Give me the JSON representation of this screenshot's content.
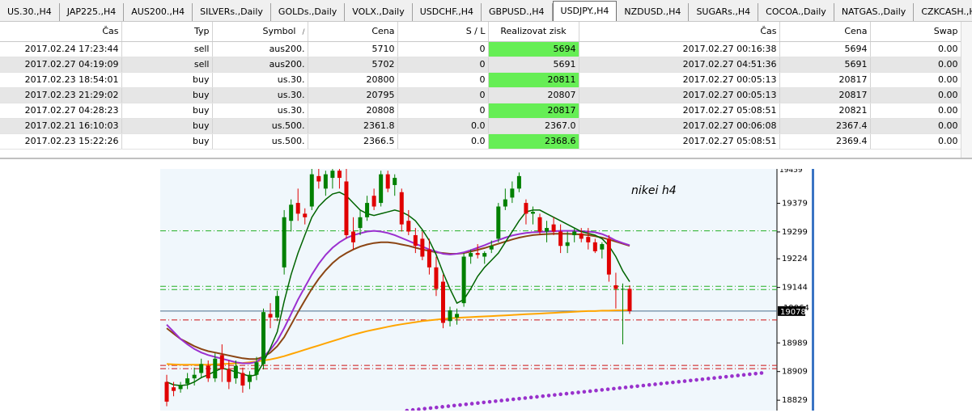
{
  "tabs": [
    {
      "label": "US.30.,H4",
      "active": false
    },
    {
      "label": "JAP225.,H4",
      "active": false
    },
    {
      "label": "AUS200.,H4",
      "active": false
    },
    {
      "label": "SILVERs.,Daily",
      "active": false
    },
    {
      "label": "GOLDs.,Daily",
      "active": false
    },
    {
      "label": "VOLX.,Daily",
      "active": false
    },
    {
      "label": "USDCHF.,H4",
      "active": false
    },
    {
      "label": "GBPUSD.,H4",
      "active": false
    },
    {
      "label": "USDJPY.,H4",
      "active": true
    },
    {
      "label": "NZDUSD.,H4",
      "active": false
    },
    {
      "label": "SUGARs.,H4",
      "active": false
    },
    {
      "label": "COCOA.,Daily",
      "active": false
    },
    {
      "label": "NATGAS.,Daily",
      "active": false
    },
    {
      "label": "CZKCASH.,H4",
      "active": false
    }
  ],
  "table": {
    "headers": {
      "open_time": "Čas",
      "type": "Typ",
      "symbol": "Symbol",
      "open_price": "Cena",
      "sl": "S / L",
      "tp": "Realizovat zisk",
      "close_time": "Čas",
      "close_price": "Cena",
      "swap": "Swap"
    },
    "sort_glyph": "/",
    "rows": [
      {
        "open_time": "2017.02.24 17:23:44",
        "type": "sell",
        "symbol": "aus200.",
        "open_price": "5710",
        "sl": "0",
        "tp": "5694",
        "close_time": "2017.02.27 00:16:38",
        "close_price": "5694",
        "swap": "0.00"
      },
      {
        "open_time": "2017.02.27 04:19:09",
        "type": "sell",
        "symbol": "aus200.",
        "open_price": "5702",
        "sl": "0",
        "tp": "5691",
        "close_time": "2017.02.27 04:51:36",
        "close_price": "5691",
        "swap": "0.00"
      },
      {
        "open_time": "2017.02.23 18:54:01",
        "type": "buy",
        "symbol": "us.30.",
        "open_price": "20800",
        "sl": "0",
        "tp": "20811",
        "close_time": "2017.02.27 00:05:13",
        "close_price": "20817",
        "swap": "0.00"
      },
      {
        "open_time": "2017.02.23 21:29:02",
        "type": "buy",
        "symbol": "us.30.",
        "open_price": "20795",
        "sl": "0",
        "tp": "20807",
        "close_time": "2017.02.27 00:05:13",
        "close_price": "20817",
        "swap": "0.00"
      },
      {
        "open_time": "2017.02.27 04:28:23",
        "type": "buy",
        "symbol": "us.30.",
        "open_price": "20808",
        "sl": "0",
        "tp": "20817",
        "close_time": "2017.02.27 05:08:51",
        "close_price": "20821",
        "swap": "0.00"
      },
      {
        "open_time": "2017.02.21 16:10:03",
        "type": "buy",
        "symbol": "us.500.",
        "open_price": "2361.8",
        "sl": "0.0",
        "tp": "2367.0",
        "close_time": "2017.02.27 00:06:08",
        "close_price": "2367.4",
        "swap": "0.00"
      },
      {
        "open_time": "2017.02.23 15:22:26",
        "type": "buy",
        "symbol": "us.500.",
        "open_price": "2366.5",
        "sl": "0.0",
        "tp": "2368.6",
        "close_time": "2017.02.27 05:08:51",
        "close_price": "2369.4",
        "swap": "0.00"
      }
    ]
  },
  "chart": {
    "title": "nikei  h4",
    "price_tag": "19078",
    "hidden_tick": "19064",
    "top_tick": "19459",
    "ticks": [
      {
        "label": "19379",
        "value": 19379
      },
      {
        "label": "19299",
        "value": 19299
      },
      {
        "label": "19224",
        "value": 19224
      },
      {
        "label": "19144",
        "value": 19144
      },
      {
        "label": "18989",
        "value": 18989
      },
      {
        "label": "18909",
        "value": 18909
      },
      {
        "label": "18829",
        "value": 18829
      }
    ],
    "current_price": 19078,
    "levels": {
      "green": [
        19302,
        19147,
        19138
      ],
      "red": [
        19053,
        18926,
        18917
      ]
    },
    "colors": {
      "background": "#f0f7fc",
      "bull": "#008000",
      "bear": "#e00000",
      "ma_fast": "#006400",
      "ma_mid": "#9b30d0",
      "ma_slow": "#8b4513",
      "ma_long": "#ffa500",
      "dots": "#9932cc",
      "price_tag_bg": "#000000"
    }
  },
  "chart_data": {
    "type": "candlestick",
    "title": "nikei  h4",
    "ylim": [
      18800,
      19475
    ],
    "candles": [
      {
        "o": 18880,
        "h": 18900,
        "l": 18812,
        "c": 18825
      },
      {
        "o": 18865,
        "h": 18880,
        "l": 18840,
        "c": 18855
      },
      {
        "o": 18860,
        "h": 18880,
        "l": 18850,
        "c": 18870
      },
      {
        "o": 18875,
        "h": 18905,
        "l": 18860,
        "c": 18890
      },
      {
        "o": 18890,
        "h": 18920,
        "l": 18870,
        "c": 18900
      },
      {
        "o": 18905,
        "h": 18945,
        "l": 18890,
        "c": 18930
      },
      {
        "o": 18925,
        "h": 18940,
        "l": 18880,
        "c": 18890
      },
      {
        "o": 18890,
        "h": 18960,
        "l": 18880,
        "c": 18945
      },
      {
        "o": 18955,
        "h": 18985,
        "l": 18880,
        "c": 18915
      },
      {
        "o": 18915,
        "h": 18940,
        "l": 18860,
        "c": 18880
      },
      {
        "o": 18890,
        "h": 18940,
        "l": 18875,
        "c": 18925
      },
      {
        "o": 18905,
        "h": 18920,
        "l": 18850,
        "c": 18870
      },
      {
        "o": 18880,
        "h": 18910,
        "l": 18860,
        "c": 18900
      },
      {
        "o": 18900,
        "h": 18950,
        "l": 18885,
        "c": 18935
      },
      {
        "o": 18930,
        "h": 19085,
        "l": 18915,
        "c": 19075
      },
      {
        "o": 19070,
        "h": 19100,
        "l": 19030,
        "c": 19060
      },
      {
        "o": 19060,
        "h": 19135,
        "l": 19050,
        "c": 19120
      },
      {
        "o": 19200,
        "h": 19360,
        "l": 19180,
        "c": 19340
      },
      {
        "o": 19330,
        "h": 19390,
        "l": 19300,
        "c": 19375
      },
      {
        "o": 19380,
        "h": 19420,
        "l": 19330,
        "c": 19350
      },
      {
        "o": 19350,
        "h": 19365,
        "l": 19320,
        "c": 19340
      },
      {
        "o": 19370,
        "h": 19475,
        "l": 19360,
        "c": 19460
      },
      {
        "o": 19455,
        "h": 19475,
        "l": 19420,
        "c": 19440
      },
      {
        "o": 19420,
        "h": 19470,
        "l": 19400,
        "c": 19460
      },
      {
        "o": 19450,
        "h": 19475,
        "l": 19420,
        "c": 19470
      },
      {
        "o": 19470,
        "h": 19475,
        "l": 19420,
        "c": 19450
      },
      {
        "o": 19440,
        "h": 19475,
        "l": 19280,
        "c": 19290
      },
      {
        "o": 19300,
        "h": 19340,
        "l": 19250,
        "c": 19270
      },
      {
        "o": 19310,
        "h": 19360,
        "l": 19290,
        "c": 19340
      },
      {
        "o": 19340,
        "h": 19400,
        "l": 19330,
        "c": 19380
      },
      {
        "o": 19400,
        "h": 19420,
        "l": 19360,
        "c": 19370
      },
      {
        "o": 19380,
        "h": 19470,
        "l": 19370,
        "c": 19460
      },
      {
        "o": 19460,
        "h": 19470,
        "l": 19410,
        "c": 19420
      },
      {
        "o": 19430,
        "h": 19460,
        "l": 19400,
        "c": 19450
      },
      {
        "o": 19410,
        "h": 19420,
        "l": 19300,
        "c": 19320
      },
      {
        "o": 19330,
        "h": 19360,
        "l": 19290,
        "c": 19300
      },
      {
        "o": 19290,
        "h": 19310,
        "l": 19240,
        "c": 19260
      },
      {
        "o": 19280,
        "h": 19300,
        "l": 19220,
        "c": 19230
      },
      {
        "o": 19250,
        "h": 19280,
        "l": 19180,
        "c": 19200
      },
      {
        "o": 19200,
        "h": 19230,
        "l": 19120,
        "c": 19140
      },
      {
        "o": 19160,
        "h": 19180,
        "l": 19030,
        "c": 19045
      },
      {
        "o": 19050,
        "h": 19090,
        "l": 19035,
        "c": 19080
      },
      {
        "o": 19060,
        "h": 19085,
        "l": 19040,
        "c": 19070
      },
      {
        "o": 19100,
        "h": 19240,
        "l": 19090,
        "c": 19230
      },
      {
        "o": 19230,
        "h": 19250,
        "l": 19210,
        "c": 19240
      },
      {
        "o": 19240,
        "h": 19265,
        "l": 19225,
        "c": 19235
      },
      {
        "o": 19230,
        "h": 19245,
        "l": 19210,
        "c": 19240
      },
      {
        "o": 19250,
        "h": 19275,
        "l": 19240,
        "c": 19260
      },
      {
        "o": 19280,
        "h": 19380,
        "l": 19270,
        "c": 19370
      },
      {
        "o": 19370,
        "h": 19420,
        "l": 19360,
        "c": 19390
      },
      {
        "o": 19395,
        "h": 19440,
        "l": 19380,
        "c": 19420
      },
      {
        "o": 19420,
        "h": 19465,
        "l": 19410,
        "c": 19455
      },
      {
        "o": 19380,
        "h": 19390,
        "l": 19320,
        "c": 19350
      },
      {
        "o": 19350,
        "h": 19370,
        "l": 19320,
        "c": 19355
      },
      {
        "o": 19340,
        "h": 19350,
        "l": 19290,
        "c": 19300
      },
      {
        "o": 19300,
        "h": 19330,
        "l": 19270,
        "c": 19310
      },
      {
        "o": 19320,
        "h": 19340,
        "l": 19290,
        "c": 19300
      },
      {
        "o": 19300,
        "h": 19320,
        "l": 19240,
        "c": 19260
      },
      {
        "o": 19260,
        "h": 19300,
        "l": 19240,
        "c": 19270
      },
      {
        "o": 19290,
        "h": 19310,
        "l": 19270,
        "c": 19300
      },
      {
        "o": 19295,
        "h": 19310,
        "l": 19270,
        "c": 19280
      },
      {
        "o": 19285,
        "h": 19310,
        "l": 19250,
        "c": 19270
      },
      {
        "o": 19270,
        "h": 19280,
        "l": 19240,
        "c": 19245
      },
      {
        "o": 19250,
        "h": 19270,
        "l": 19225,
        "c": 19265
      },
      {
        "o": 19280,
        "h": 19290,
        "l": 19160,
        "c": 19180
      },
      {
        "o": 19150,
        "h": 19185,
        "l": 19085,
        "c": 19140
      },
      {
        "o": 19140,
        "h": 19155,
        "l": 18985,
        "c": 19140
      },
      {
        "o": 19140,
        "h": 19150,
        "l": 19070,
        "c": 19078
      }
    ],
    "ma_fast": [
      18880,
      18872,
      18870,
      18872,
      18880,
      18892,
      18900,
      18910,
      18918,
      18914,
      18908,
      18902,
      18896,
      18900,
      18935,
      18975,
      19020,
      19105,
      19180,
      19240,
      19290,
      19340,
      19370,
      19390,
      19405,
      19410,
      19400,
      19380,
      19360,
      19350,
      19345,
      19350,
      19355,
      19360,
      19355,
      19345,
      19330,
      19305,
      19275,
      19235,
      19185,
      19140,
      19100,
      19110,
      19140,
      19175,
      19200,
      19220,
      19240,
      19270,
      19300,
      19330,
      19355,
      19360,
      19360,
      19350,
      19340,
      19330,
      19320,
      19310,
      19300,
      19295,
      19290,
      19280,
      19260,
      19230,
      19190,
      19160
    ],
    "ma_mid": [
      19040,
      19020,
      19000,
      18985,
      18972,
      18962,
      18955,
      18950,
      18945,
      18940,
      18935,
      18932,
      18932,
      18936,
      18950,
      18970,
      18995,
      19030,
      19070,
      19110,
      19145,
      19180,
      19210,
      19235,
      19255,
      19270,
      19282,
      19290,
      19295,
      19300,
      19302,
      19300,
      19296,
      19290,
      19282,
      19274,
      19266,
      19258,
      19250,
      19244,
      19238,
      19236,
      19238,
      19242,
      19248,
      19255,
      19262,
      19270,
      19276,
      19283,
      19289,
      19293,
      19296,
      19298,
      19299,
      19300,
      19301,
      19302,
      19302,
      19302,
      19301,
      19300,
      19298,
      19293,
      19285,
      19275,
      19268,
      19262
    ],
    "ma_slow": [
      19030,
      19015,
      19000,
      18990,
      18980,
      18972,
      18966,
      18962,
      18958,
      18954,
      18950,
      18946,
      18944,
      18944,
      18950,
      18962,
      18980,
      19005,
      19040,
      19075,
      19108,
      19140,
      19168,
      19192,
      19212,
      19228,
      19240,
      19250,
      19258,
      19264,
      19268,
      19270,
      19270,
      19268,
      19264,
      19260,
      19255,
      19250,
      19246,
      19242,
      19240,
      19238,
      19238,
      19240,
      19244,
      19249,
      19254,
      19260,
      19266,
      19272,
      19278,
      19283,
      19287,
      19290,
      19292,
      19293,
      19294,
      19294,
      19294,
      19293,
      19292,
      19290,
      19287,
      19283,
      19278,
      19272,
      19266,
      19260
    ],
    "ma_long": [
      18930,
      18929,
      18928,
      18928,
      18928,
      18928,
      18928,
      18929,
      18930,
      18931,
      18932,
      18933,
      18935,
      18937,
      18940,
      18943,
      18947,
      18952,
      18958,
      18964,
      18970,
      18976,
      18982,
      18988,
      18994,
      19000,
      19006,
      19012,
      19017,
      19022,
      19026,
      19030,
      19034,
      19038,
      19041,
      19044,
      19047,
      19050,
      19052,
      19054,
      19056,
      19058,
      19059,
      19060,
      19061,
      19062,
      19063,
      19064,
      19065,
      19066,
      19067,
      19068,
      19069,
      19070,
      19071,
      19072,
      19073,
      19074,
      19075,
      19076,
      19077,
      19078,
      19078,
      19079,
      19079,
      19080,
      19080,
      19081
    ],
    "dots": [
      [
        0.4,
        18800
      ],
      [
        0.975,
        18905
      ]
    ]
  }
}
